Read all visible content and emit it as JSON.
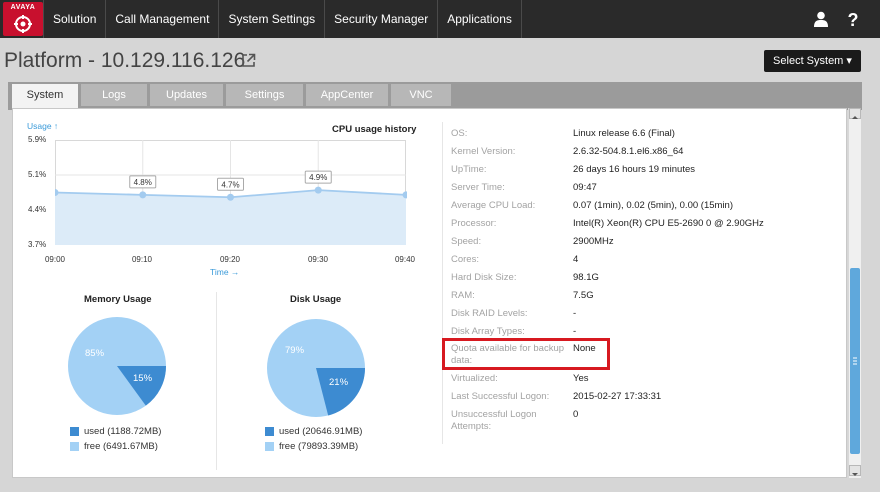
{
  "brand": {
    "logo_text": "AVAYA",
    "accent": "#c8102e"
  },
  "nav": {
    "items": [
      {
        "label": "Solution"
      },
      {
        "label": "Call Management"
      },
      {
        "label": "System Settings"
      },
      {
        "label": "Security Manager"
      },
      {
        "label": "Applications"
      }
    ],
    "user_icon": "user-icon",
    "help_icon": "help-icon"
  },
  "header": {
    "title": "Platform - 10.129.116.126",
    "external_icon": "external-link-icon",
    "select_system_label": "Select System ▾"
  },
  "tabs": [
    {
      "label": "System",
      "active": true
    },
    {
      "label": "Logs"
    },
    {
      "label": "Updates"
    },
    {
      "label": "Settings"
    },
    {
      "label": "AppCenter"
    },
    {
      "label": "VNC"
    }
  ],
  "chart_data": [
    {
      "type": "area",
      "title": "CPU usage history",
      "ylabel": "Usage ↑",
      "xlabel": "Time →",
      "x": [
        "09:00",
        "09:10",
        "09:20",
        "09:30",
        "09:40"
      ],
      "yticks": [
        "5.9%",
        "5.1%",
        "4.4%",
        "3.7%"
      ],
      "ylim": [
        3.7,
        5.9
      ],
      "series": [
        {
          "values": [
            4.8,
            4.75,
            4.7,
            4.85,
            4.75
          ],
          "data_labels": [
            "",
            "4.8%",
            "4.7%",
            "4.9%",
            ""
          ]
        }
      ],
      "grid": true
    },
    {
      "type": "pie",
      "title": "Memory Usage",
      "slices": [
        {
          "name": "used (1188.72MB)",
          "value": 15,
          "label": "15%",
          "color": "#3d8bd1"
        },
        {
          "name": "free (6491.67MB)",
          "value": 85,
          "label": "85%",
          "color": "#a3d1f5"
        }
      ]
    },
    {
      "type": "pie",
      "title": "Disk Usage",
      "slices": [
        {
          "name": "used (20646.91MB)",
          "value": 21,
          "label": "21%",
          "color": "#3d8bd1"
        },
        {
          "name": "free (79893.39MB)",
          "value": 79,
          "label": "79%",
          "color": "#a3d1f5"
        }
      ]
    }
  ],
  "info": [
    {
      "key": "OS:",
      "value": "Linux release 6.6 (Final)"
    },
    {
      "key": "Kernel Version:",
      "value": "2.6.32-504.8.1.el6.x86_64"
    },
    {
      "key": "UpTime:",
      "value": "26 days 16 hours 19 minutes"
    },
    {
      "key": "Server Time:",
      "value": "09:47"
    },
    {
      "key": "Average CPU Load:",
      "value": "0.07 (1min), 0.02 (5min), 0.00 (15min)"
    },
    {
      "key": "Processor:",
      "value": "Intel(R) Xeon(R) CPU E5-2690 0 @ 2.90GHz"
    },
    {
      "key": "Speed:",
      "value": "2900MHz"
    },
    {
      "key": "Cores:",
      "value": "4"
    },
    {
      "key": "Hard Disk Size:",
      "value": "98.1G"
    },
    {
      "key": "RAM:",
      "value": "7.5G"
    },
    {
      "key": "Disk RAID Levels:",
      "value": "-"
    },
    {
      "key": "Disk Array Types:",
      "value": "-"
    },
    {
      "key": "Quota available for backup",
      "key2": "data:",
      "value": "None"
    },
    {
      "key": "Virtualized:",
      "value": "Yes"
    },
    {
      "key": "Last Successful Logon:",
      "value": "2015-02-27 17:33:31"
    },
    {
      "key": "Unsuccessful Logon",
      "key2": "Attempts:",
      "value": "0"
    }
  ],
  "highlight_color": "#d71920"
}
